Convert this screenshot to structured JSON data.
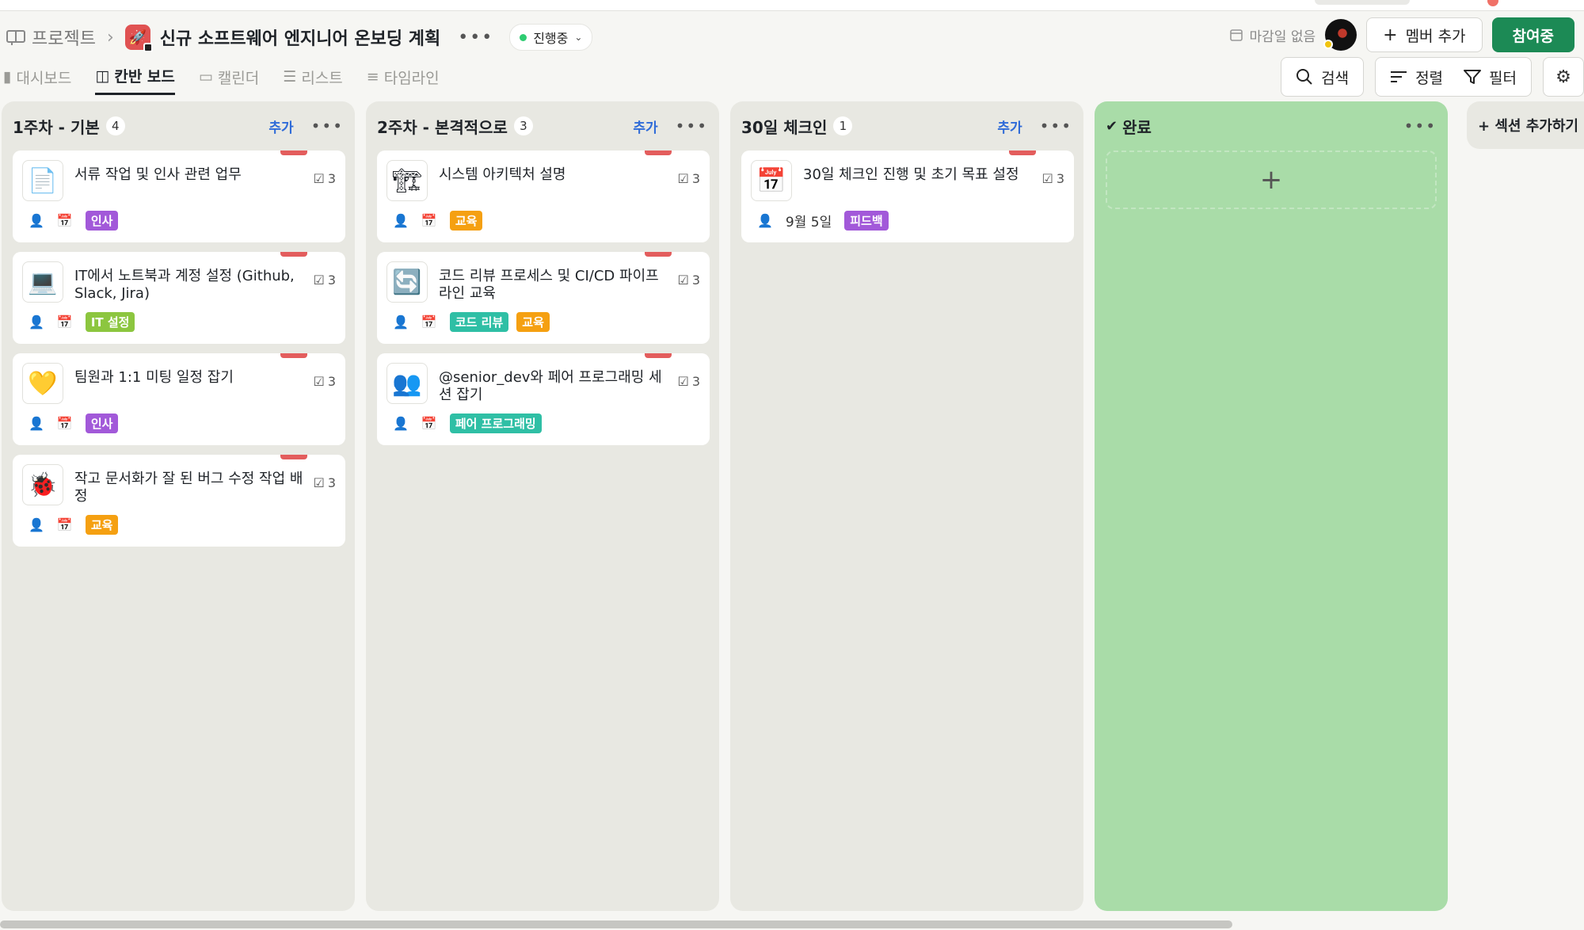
{
  "colors": {
    "accent_green": "#1c8a55",
    "done_column": "#a9dca8",
    "column_bg": "#e8e8e2",
    "link_blue": "#2f6bd8",
    "priority_flag": "#e35d5d",
    "status_dot": "#2ecc71"
  },
  "breadcrumb": {
    "root": "프로젝트",
    "project_title": "신규 소프트웨어 엔지니어 온보딩 계획",
    "status": "진행중"
  },
  "header_actions": {
    "due_label": "마감일 없음",
    "add_member": "멤버 추가",
    "join": "참여중"
  },
  "tabs": [
    {
      "label": "대시보드",
      "icon": "bar-chart-icon"
    },
    {
      "label": "칸반 보드",
      "icon": "board-icon"
    },
    {
      "label": "캘린더",
      "icon": "calendar-icon"
    },
    {
      "label": "리스트",
      "icon": "list-icon"
    },
    {
      "label": "타임라인",
      "icon": "timeline-icon"
    }
  ],
  "tools": {
    "search": "검색",
    "sort": "정렬",
    "filter": "필터"
  },
  "columns": [
    {
      "title": "1주차 - 기본",
      "count": "4",
      "add": "추가",
      "cards": [
        {
          "title": "서류 작업 및 인사 관련 업무",
          "icon": "📄",
          "subtasks": "3",
          "date": "",
          "tags": [
            {
              "label": "인사",
              "color": "#a259d9"
            }
          ]
        },
        {
          "title": "IT에서 노트북과 계정 설정 (Github, Slack, Jira)",
          "icon": "💻",
          "subtasks": "3",
          "date": "",
          "tags": [
            {
              "label": "IT 설정",
              "color": "#8cc63f"
            }
          ]
        },
        {
          "title": "팀원과 1:1 미팅 일정 잡기",
          "icon": "💛",
          "subtasks": "3",
          "date": "",
          "tags": [
            {
              "label": "인사",
              "color": "#a259d9"
            }
          ]
        },
        {
          "title": "작고 문서화가 잘 된 버그 수정 작업 배정",
          "icon": "🐞",
          "subtasks": "3",
          "date": "",
          "tags": [
            {
              "label": "교육",
              "color": "#f5a011"
            }
          ]
        }
      ]
    },
    {
      "title": "2주차 - 본격적으로",
      "count": "3",
      "add": "추가",
      "cards": [
        {
          "title": "시스템 아키텍처 설명",
          "icon": "🏗",
          "subtasks": "3",
          "date": "",
          "tags": [
            {
              "label": "교육",
              "color": "#f5a011"
            }
          ]
        },
        {
          "title": "코드 리뷰 프로세스 및 CI/CD 파이프라인 교육",
          "icon": "🔄",
          "subtasks": "3",
          "date": "",
          "tags": [
            {
              "label": "코드 리뷰",
              "color": "#2fbfa5"
            },
            {
              "label": "교육",
              "color": "#f5a011"
            }
          ]
        },
        {
          "title": "@senior_dev와 페어 프로그래밍 세션 잡기",
          "icon": "👥",
          "subtasks": "3",
          "date": "",
          "tags": [
            {
              "label": "페어 프로그래밍",
              "color": "#2fbfa5"
            }
          ]
        }
      ]
    },
    {
      "title": "30일 체크인",
      "count": "1",
      "add": "추가",
      "cards": [
        {
          "title": "30일 체크인 진행 및 초기 목표 설정",
          "icon": "📅",
          "subtasks": "3",
          "date": "9월 5일",
          "tags": [
            {
              "label": "피드백",
              "color": "#a259d9"
            }
          ]
        }
      ]
    },
    {
      "title": "완료",
      "count": "",
      "add": "",
      "cards": []
    }
  ],
  "add_section": "+ 섹션 추가하기"
}
